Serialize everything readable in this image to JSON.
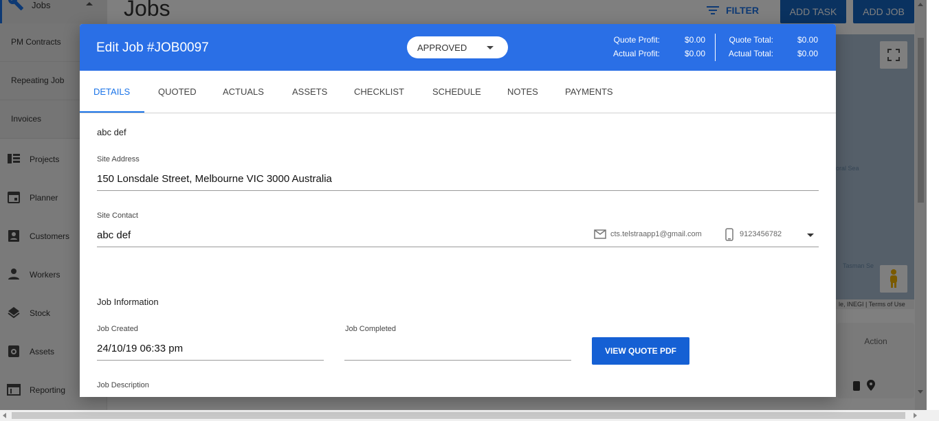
{
  "app": {
    "page_title": "Jobs",
    "header": {
      "filter_label": "FILTER",
      "add_task_label": "ADD TASK",
      "add_job_label": "ADD JOB"
    },
    "sidebar": {
      "jobs_label": "Jobs",
      "sub_items": [
        "PM Contracts",
        "Repeating Job",
        "Invoices"
      ],
      "items": [
        {
          "label": "Projects",
          "icon": "projects-icon"
        },
        {
          "label": "Planner",
          "icon": "calendar-icon"
        },
        {
          "label": "Customers",
          "icon": "contacts-icon"
        },
        {
          "label": "Workers",
          "icon": "person-icon"
        },
        {
          "label": "Stock",
          "icon": "layers-icon"
        },
        {
          "label": "Assets",
          "icon": "assets-icon"
        },
        {
          "label": "Reporting",
          "icon": "reporting-icon"
        }
      ]
    },
    "map": {
      "label_sea1": "oral Sea",
      "label_sea2": "Tasman Se",
      "attribution": "le, INEGI | Terms of Use"
    },
    "table": {
      "action_header": "Action"
    }
  },
  "modal": {
    "title": "Edit Job #JOB0097",
    "status": "APPROVED",
    "financials": {
      "quote_profit_label": "Quote Profit:",
      "quote_profit": "$0.00",
      "actual_profit_label": "Actual Profit:",
      "actual_profit": "$0.00",
      "quote_total_label": "Quote Total:",
      "quote_total": "$0.00",
      "actual_total_label": "Actual Total:",
      "actual_total": "$0.00"
    },
    "tabs": [
      "DETAILS",
      "QUOTED",
      "ACTUALS",
      "ASSETS",
      "CHECKLIST",
      "SCHEDULE",
      "NOTES",
      "PAYMENTS"
    ],
    "active_tab": "DETAILS",
    "details": {
      "customer_name": "abc def",
      "site_address_label": "Site Address",
      "site_address": "150 Lonsdale Street, Melbourne VIC 3000 Australia",
      "site_contact_label": "Site Contact",
      "site_contact": "abc def",
      "contact_email": "cts.telstraapp1@gmail.com",
      "contact_phone": "9123456782",
      "job_info_title": "Job Information",
      "job_created_label": "Job Created",
      "job_created": "24/10/19 06:33 pm",
      "job_completed_label": "Job Completed",
      "job_completed": "",
      "view_quote_pdf": "VIEW QUOTE PDF",
      "job_description_label": "Job Description"
    }
  },
  "colors": {
    "primary": "#2a6fe6",
    "button": "#1560d4",
    "tab_active": "#1a73e8"
  }
}
